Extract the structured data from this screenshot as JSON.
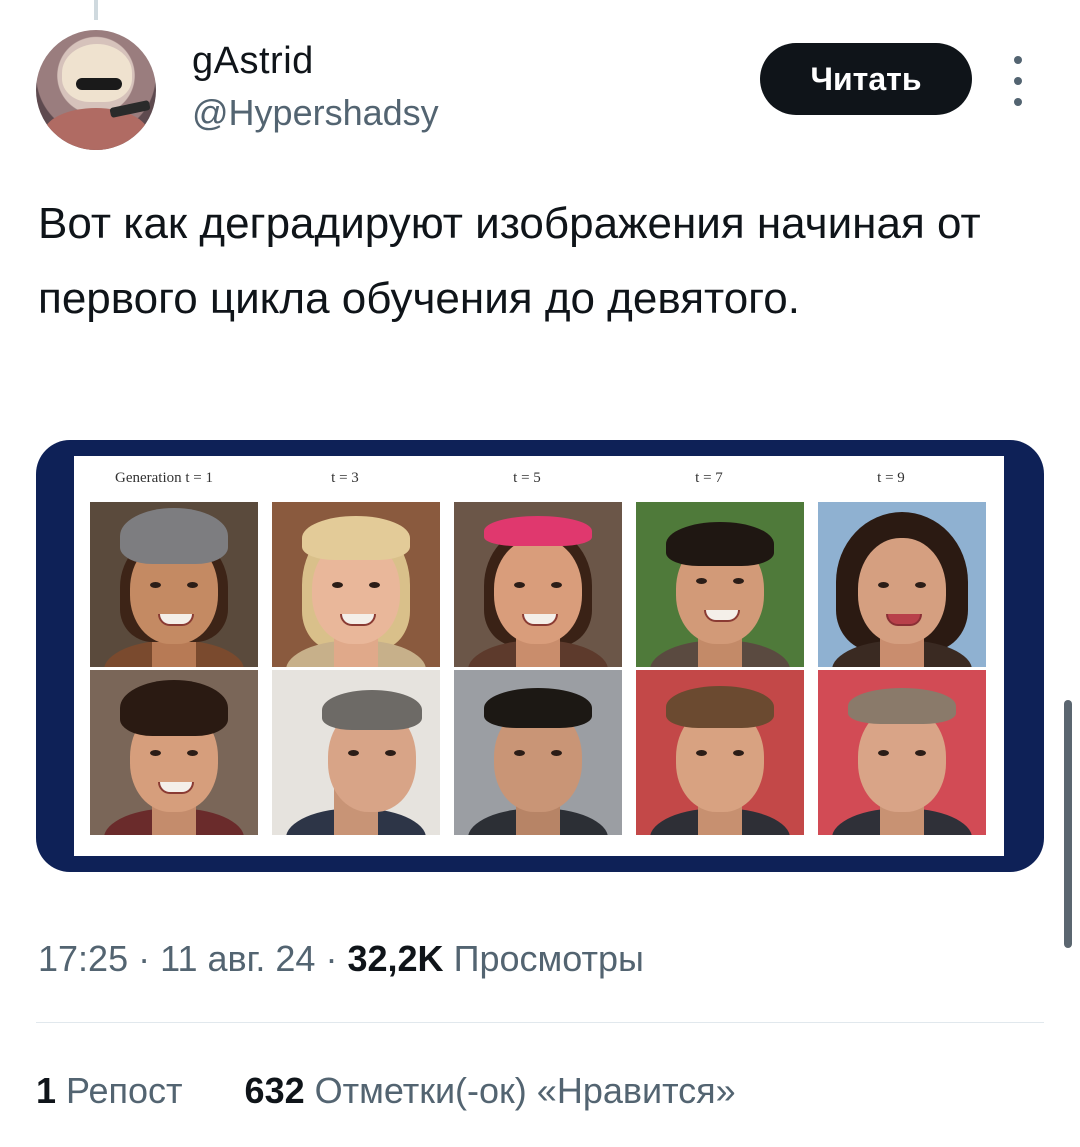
{
  "tweet": {
    "display_name": "gAstrid",
    "handle": "@Hypershadsy",
    "follow_label": "Читать",
    "text": "Вот как деградируют изображения начиная от первого цикла обучения до девятого."
  },
  "media": {
    "generation_labels": [
      "Generation t = 1",
      "t = 3",
      "t = 5",
      "t = 7",
      "t = 9"
    ]
  },
  "meta": {
    "time": "17:25",
    "date": "11 авг. 24",
    "separator": "·",
    "views_count": "32,2K",
    "views_label": "Просмотры"
  },
  "stats": {
    "reposts_count": "1",
    "reposts_label": "Репост",
    "likes_count": "632",
    "likes_label": "Отметки(-ок) «Нравится»"
  },
  "colors": {
    "media_frame": "#0e2157",
    "follow_button": "#0f1419",
    "secondary_text": "#536471"
  }
}
